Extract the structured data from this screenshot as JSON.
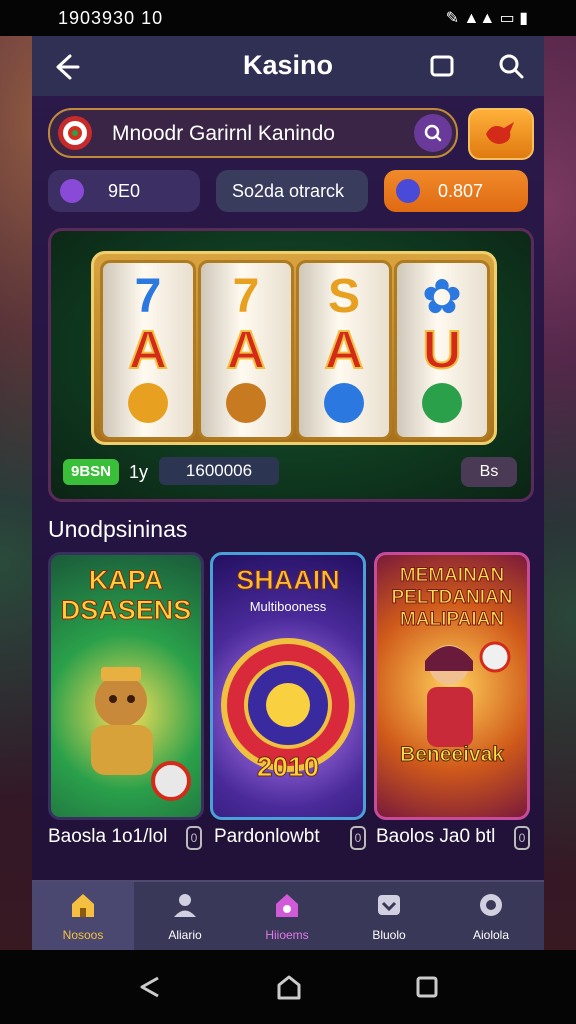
{
  "status_bar": {
    "time": "1903930 10",
    "icons": "✎ ▲▲ ▭ ▮"
  },
  "header": {
    "title": "Kasino"
  },
  "search": {
    "text": "Mnoodr Garirnl Kanindo"
  },
  "chips": [
    {
      "label": "9E0",
      "icon_color": "#8a4ad8"
    },
    {
      "label": "So2da otrarck"
    },
    {
      "label": "0.807",
      "icon_color": "#4a4ad8"
    }
  ],
  "slot": {
    "reels": [
      {
        "seven": "7",
        "seven_color": "#2a78e0",
        "letter": "A",
        "icon_color": "#e8a020"
      },
      {
        "seven": "7",
        "seven_color": "#e8a020",
        "letter": "A",
        "icon_color": "#c87a20"
      },
      {
        "seven": "S",
        "seven_color": "#e8a020",
        "letter": "A",
        "icon_color": "#2a78e0"
      },
      {
        "seven": "✿",
        "seven_color": "#2a78e0",
        "letter": "U",
        "icon_color": "#2aa04a"
      }
    ],
    "badge_green": "9BSN",
    "badge_1y": "1y",
    "score": "1600006",
    "badge_right": "Bs"
  },
  "section": {
    "title": "Unodpsininas"
  },
  "cards": [
    {
      "title": "KAPA DSASENS",
      "title_color": "#ffd23a",
      "bottom": "",
      "label": "Baosla 1o1/lol"
    },
    {
      "title": "SHAAIN",
      "sub": "Multibooness",
      "title_color": "#ffb83a",
      "bottom": "2010",
      "label": "Pardonlowbt"
    },
    {
      "title": "MEMAINAN PELTDANIAN MALIPAIAN",
      "title_color": "#ffe04a",
      "bottom": "Beneeivak",
      "label": "Baolos Ja0 btl"
    }
  ],
  "bottom_nav": [
    {
      "label": "Nosoos",
      "color": "#f5c040"
    },
    {
      "label": "Aliario",
      "color": "#d0d0e0"
    },
    {
      "label": "Hiioems",
      "color": "#d05ad8"
    },
    {
      "label": "Bluolo",
      "color": "#d0d0e0"
    },
    {
      "label": "Aiolola",
      "color": "#d0d0e0"
    }
  ]
}
